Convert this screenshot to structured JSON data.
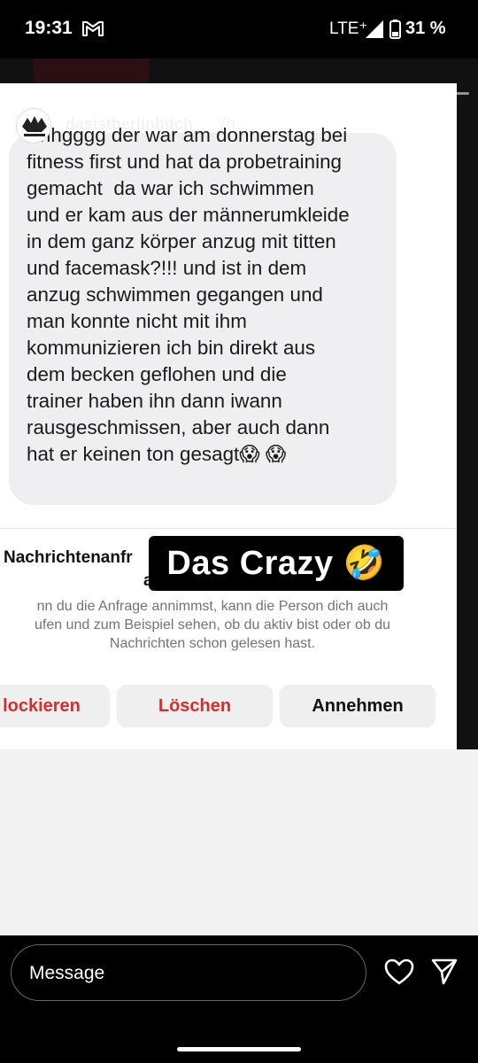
{
  "status_bar": {
    "time": "19:31",
    "network": "LTE⁺",
    "battery": "31 %",
    "icons": [
      "gmail-icon",
      "signal-icon",
      "battery-icon"
    ]
  },
  "story": {
    "username": "dasistberlinbitch",
    "age": "7h",
    "progress": 1
  },
  "message": {
    "text": "Ehhgggg der war am donnerstag bei\nfitness first und hat da probetraining\ngemacht  da war ich schwimmen\nund er kam aus der männerumkleide\nin dem ganz körper anzug mit titten\nund facemask?!!! und ist in dem\nanzug schwimmen gegangen und\nman konnte nicht mit ihm\nkommunizieren ich bin direkt aus\ndem becken geflohen und die\ntrainer haben ihn dann iwann\nrausgeschmissen, aber auch dann\nhat er keinen ton gesagt😱 😱"
  },
  "request": {
    "title_line1": "Nachrichtenanfr",
    "title_line2": "a",
    "description": "nn du die Anfrage annimmst, kann die Person dich auch\nufen und zum Beispiel sehen, ob du aktiv bist oder ob du\nNachrichten schon gelesen hast.",
    "block_label": "lockieren",
    "delete_label": "Löschen",
    "accept_label": "Annehmen"
  },
  "sticker": {
    "text": "Das Crazy 🤣"
  },
  "reply_bar": {
    "placeholder": "Message",
    "icons": [
      "heart-icon",
      "send-icon"
    ]
  },
  "colors": {
    "danger": "#d72d2d",
    "bubble": "#efeff1",
    "background": "#000000"
  }
}
